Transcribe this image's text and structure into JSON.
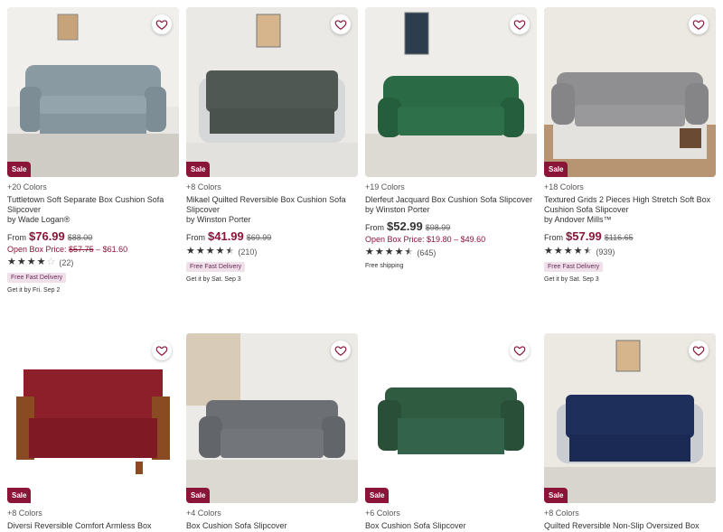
{
  "colors": {
    "accent": "#8a1538",
    "sale_bg": "#8a1538",
    "pill_bg": "#efe0ea"
  },
  "icons": {
    "favorite": "heart-outline-icon",
    "star": "star-icon"
  },
  "products": [
    {
      "colors": "+20 Colors",
      "title": "Tuttletown Soft Separate Box Cushion Sofa Slipcover",
      "by": "by Wade Logan®",
      "from": "From",
      "price": "$76.99",
      "was": "$88.00",
      "open_box": {
        "label": "Open Box Price:",
        "was": "$57.75",
        "range": "– $61.60"
      },
      "rating": 4.0,
      "reviews": "(22)",
      "pill": "Free Fast Delivery",
      "ship": "Get it by Fri. Sep 2",
      "sale": "Sale"
    },
    {
      "colors": "+8 Colors",
      "title": "Mikael Quilted Reversible Box Cushion Sofa Slipcover",
      "by": "by Winston Porter",
      "from": "From",
      "price": "$41.99",
      "was": "$69.99",
      "rating": 4.5,
      "reviews": "(210)",
      "pill": "Free Fast Delivery",
      "ship": "Get it by Sat. Sep 3",
      "sale": "Sale"
    },
    {
      "colors": "+19 Colors",
      "title": "Dlerfeut Jacquard Box Cushion Sofa Slipcover",
      "by": "by Winston Porter",
      "from": "From",
      "price": "$52.99",
      "was": "$98.99",
      "open_box": {
        "label": "Open Box Price:",
        "was": "",
        "range": "$19.80 – $49.60"
      },
      "rating": 4.5,
      "reviews": "(645)",
      "ship": "Free shipping",
      "sale": ""
    },
    {
      "colors": "+18 Colors",
      "title": "Textured Grids 2 Pieces High Stretch Soft Box Cushion Sofa Slipcover",
      "by": "by Andover Mills™",
      "from": "From",
      "price": "$57.99",
      "was": "$116.65",
      "rating": 4.5,
      "reviews": "(939)",
      "pill": "Free Fast Delivery",
      "ship": "Get it by Sat. Sep 3",
      "sale": "Sale"
    },
    {
      "colors": "+8 Colors",
      "title": "Diversi Reversible Comfort Armless Box",
      "sale": "Sale"
    },
    {
      "colors": "+4 Colors",
      "title": "Box Cushion Sofa Slipcover",
      "sale": "Sale"
    },
    {
      "colors": "+6 Colors",
      "title": "Box Cushion Sofa Slipcover",
      "sale": "Sale"
    },
    {
      "colors": "+8 Colors",
      "title": "Quilted Reversible Non-Slip Oversized Box",
      "sale": "Sale"
    }
  ]
}
